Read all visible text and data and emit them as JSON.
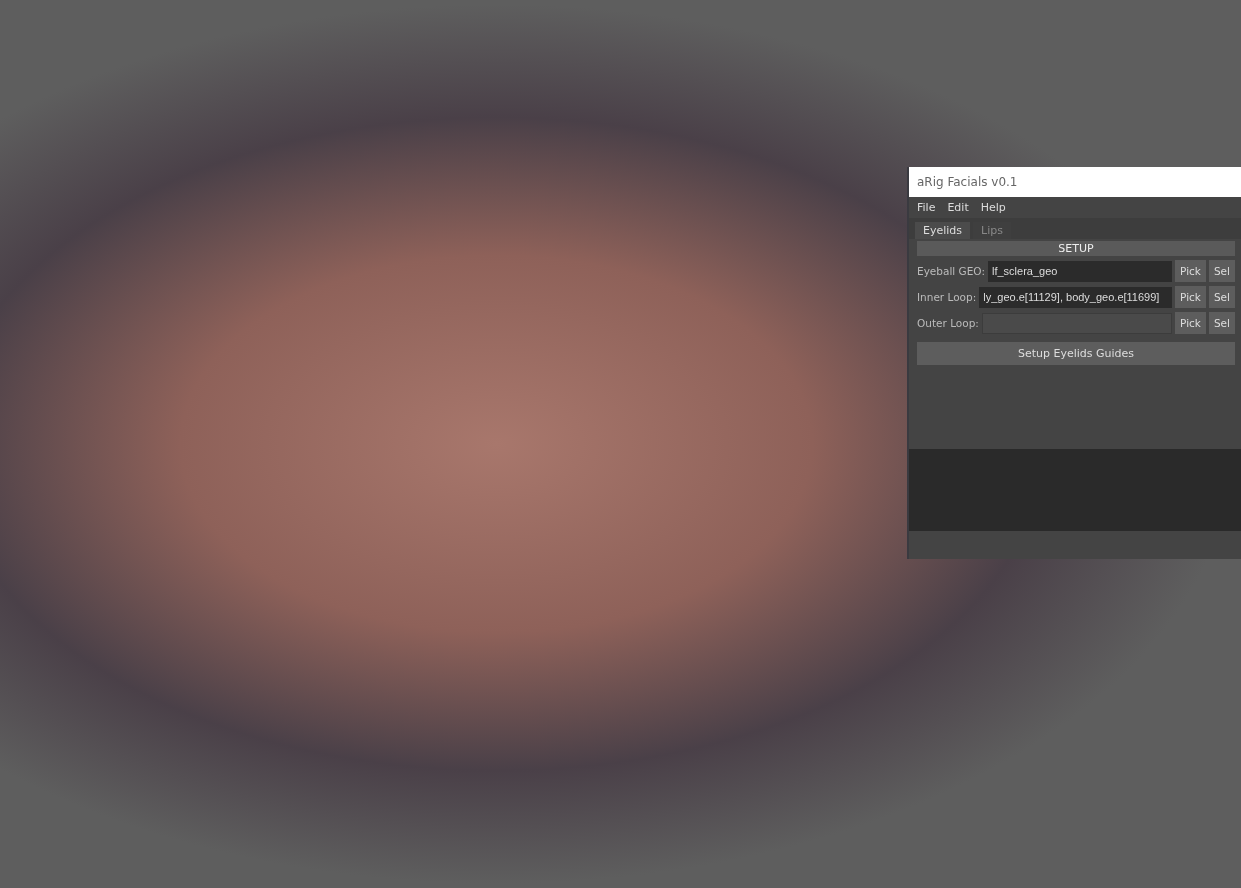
{
  "window": {
    "title": "aRig Facials v0.1"
  },
  "menu": [
    "File",
    "Edit",
    "Help"
  ],
  "tabs": [
    {
      "label": "Eyelids",
      "selected": true
    },
    {
      "label": "Lips",
      "selected": false
    }
  ],
  "section": "SETUP",
  "rows": [
    {
      "label": "Eyeball GEO:",
      "value": "lf_sclera_geo",
      "buttons": [
        "Pick",
        "Sel"
      ]
    },
    {
      "label": "Inner Loop:",
      "value": "ly_geo.e[11129], body_geo.e[11699]",
      "buttons": [
        "Pick",
        "Sel"
      ]
    },
    {
      "label": "Outer Loop:",
      "buttons": [
        "Pick",
        "Sel"
      ]
    }
  ],
  "action": "Setup Eyelids Guides"
}
